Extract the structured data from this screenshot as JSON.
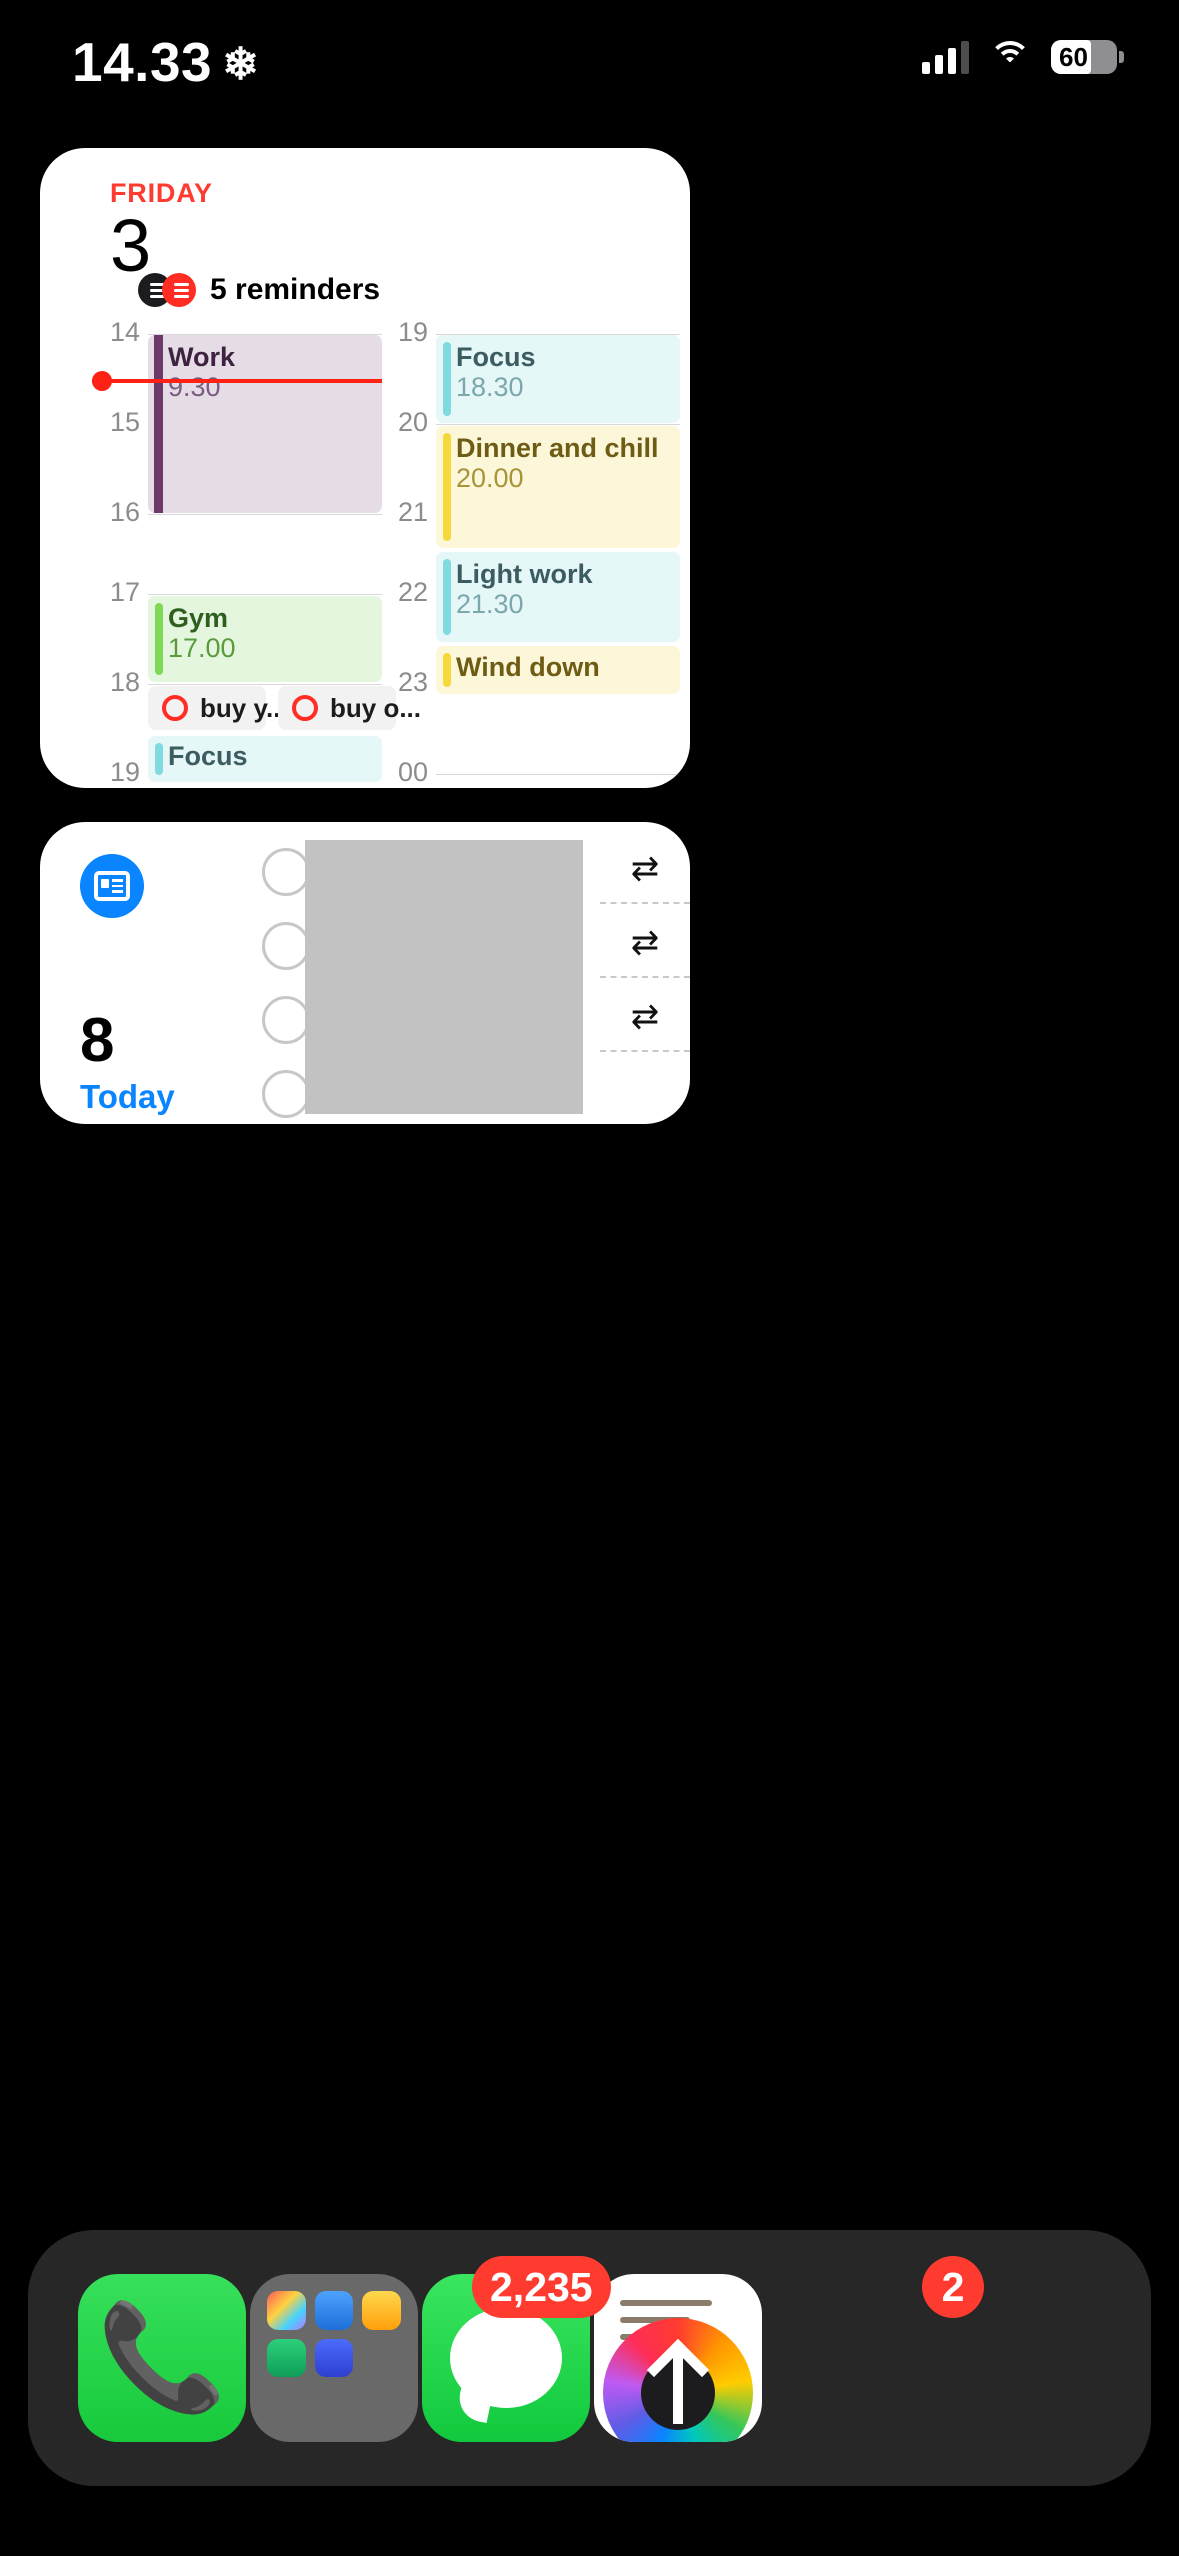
{
  "status_bar": {
    "time": "14.33",
    "snowflake_icon": "snowflake-icon",
    "signal_icon": "cellular-signal-icon",
    "wifi_icon": "wifi-icon",
    "battery_level": "60"
  },
  "calendar_widget": {
    "weekday": "FRIDAY",
    "date": "3",
    "reminders_summary": "5 reminders",
    "reminders_icon": "reminders-list-icon",
    "now_time": "14.33",
    "left_column": {
      "hours": [
        "14",
        "15",
        "16",
        "17",
        "18",
        "19"
      ],
      "events": [
        {
          "title": "Work",
          "time": "9.30",
          "color": "purple"
        },
        {
          "title": "Gym",
          "time": "17.00",
          "color": "green"
        },
        {
          "title": "Focus",
          "time": "",
          "color": "cyan"
        }
      ],
      "reminders": [
        {
          "label": "buy y...",
          "checked": false
        },
        {
          "label": "buy o...",
          "checked": false
        }
      ]
    },
    "right_column": {
      "hours": [
        "19",
        "20",
        "21",
        "22",
        "23",
        "00"
      ],
      "events": [
        {
          "title": "Focus",
          "time": "18.30",
          "color": "cyan"
        },
        {
          "title": "Dinner and chill",
          "time": "20.00",
          "color": "yellow"
        },
        {
          "title": "Light work",
          "time": "21.30",
          "color": "cyan"
        },
        {
          "title": "Wind down",
          "time": "",
          "color": "yellow"
        }
      ]
    }
  },
  "list_widget": {
    "app_icon": "news-list-app-icon",
    "count": "8",
    "subtitle": "Today",
    "checkbox_icon": "circle-checkbox-icon",
    "repeat_icon": "↻",
    "rows": [
      {
        "checkbox": "○",
        "repeat": "⇄"
      },
      {
        "checkbox": "○",
        "repeat": "⇄"
      },
      {
        "checkbox": "○",
        "repeat": "⇄"
      },
      {
        "checkbox": "○",
        "repeat": ""
      }
    ]
  },
  "dock": {
    "apps": [
      {
        "name": "Phone",
        "icon": "phone-icon",
        "badge": ""
      },
      {
        "name": "Folder",
        "icon": "app-folder-icon",
        "badge": "2,235"
      },
      {
        "name": "Messages",
        "icon": "messages-icon",
        "badge": "2"
      },
      {
        "name": "Photos",
        "icon": "photos-icon",
        "badge": ""
      }
    ]
  },
  "colors": {
    "accent_red": "#ff3b30",
    "accent_blue": "#0a84ff",
    "widget_bg": "#ffffff",
    "wallpaper": "#000000"
  }
}
